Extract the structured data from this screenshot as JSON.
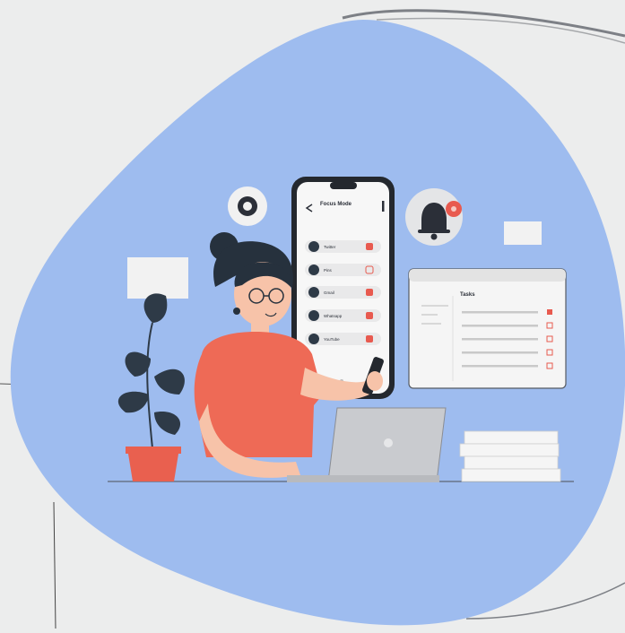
{
  "illustration": {
    "phone": {
      "title": "Focus Mode",
      "apps": [
        "Twitter",
        "Pins",
        "Gmail",
        "Whatsapp",
        "YouTube"
      ]
    },
    "tasks_window": {
      "title": "Tasks",
      "rows": 5
    },
    "notification_badge": "●",
    "colors": {
      "background": "#eceded",
      "blob": "#9ebcef",
      "shirt": "#ee6a56",
      "hair": "#26313d",
      "skin": "#f7c3a9",
      "plant_pot": "#e9604f",
      "plant_leaves": "#2e3a47",
      "laptop": "#c9cbcf",
      "phone_frame": "#24282e",
      "accent_red": "#e85a4f"
    }
  }
}
